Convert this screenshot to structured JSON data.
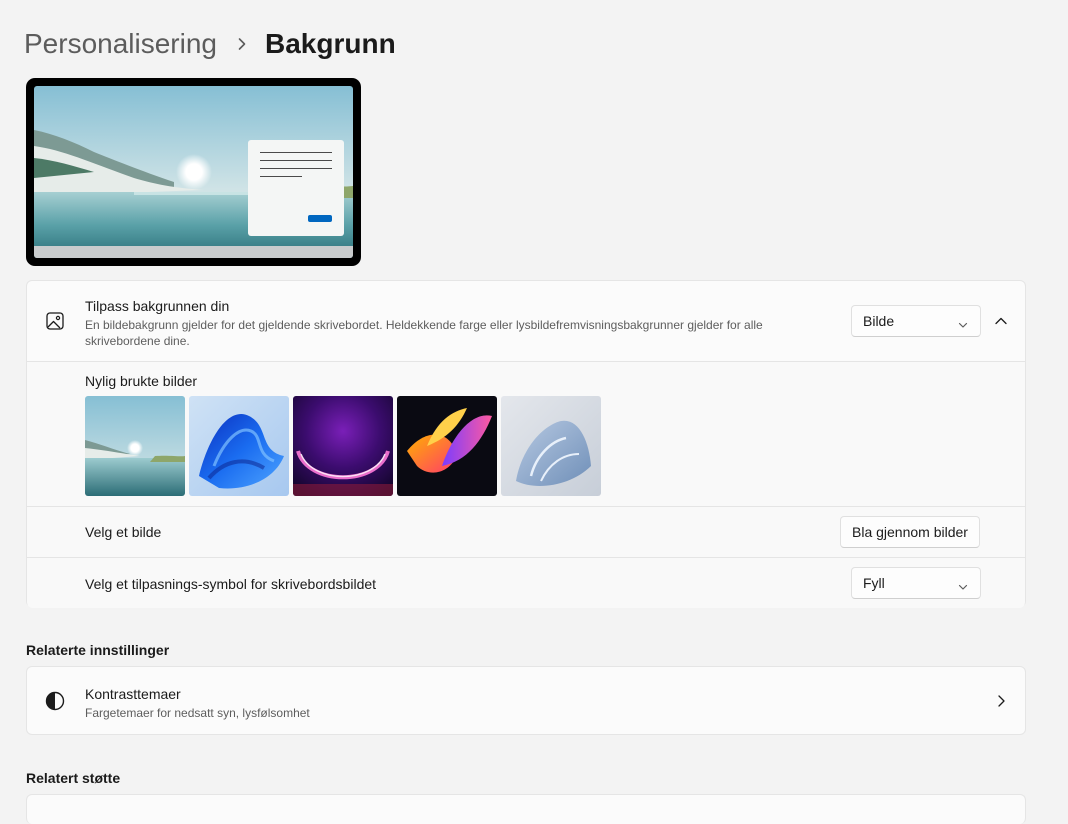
{
  "breadcrumb": {
    "parent": "Personalisering",
    "current": "Bakgrunn"
  },
  "personalize": {
    "title": "Tilpass bakgrunnen din",
    "description": "En bildebakgrunn gjelder for det gjeldende skrivebordet. Heldekkende farge eller lysbildefremvisningsbakgrunner gjelder for alle skrivebordene dine.",
    "type_value": "Bilde"
  },
  "recent": {
    "label": "Nylig brukte bilder",
    "images": [
      "image-1",
      "image-2",
      "image-3",
      "image-4",
      "image-5"
    ]
  },
  "choose_photo": {
    "label": "Velg et bilde",
    "button": "Bla gjennom bilder"
  },
  "fit": {
    "label": "Velg et tilpasnings-symbol for skrivebordsbildet",
    "value": "Fyll"
  },
  "related_settings": {
    "header": "Relaterte innstillinger",
    "contrast": {
      "title": "Kontrasttemaer",
      "description": "Fargetemaer for nedsatt syn, lysfølsomhet"
    }
  },
  "related_support": {
    "header": "Relatert støtte"
  },
  "colors": {
    "accent": "#0067c0",
    "background": "#f3f3f3",
    "card": "#fbfbfb"
  }
}
